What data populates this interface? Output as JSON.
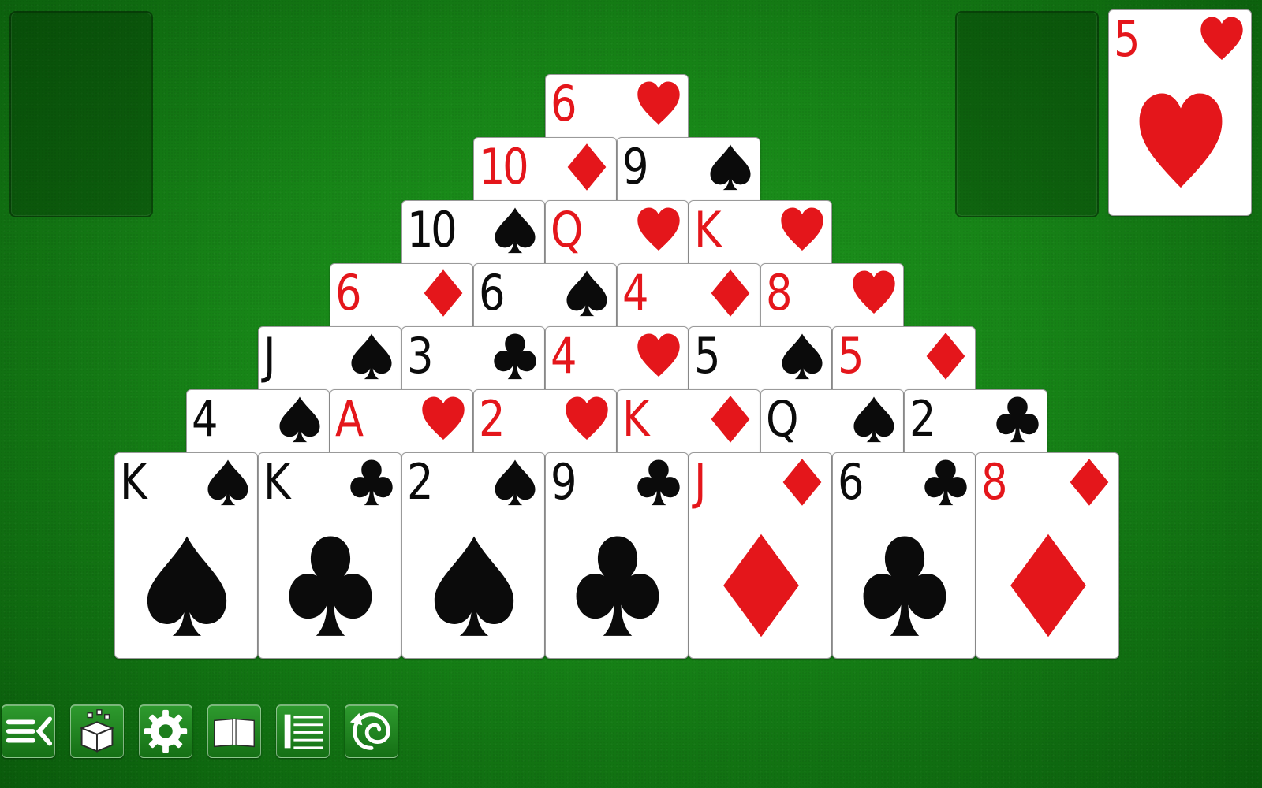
{
  "colors": {
    "felt": "#178417",
    "red_suit": "#e4161b",
    "black_suit": "#0b0b0b",
    "card_face": "#ffffff"
  },
  "waste": {
    "label": ""
  },
  "stock": {
    "label": ""
  },
  "drawn_card": {
    "rank": "5",
    "suit": "hearts"
  },
  "pyramid": [
    [
      {
        "rank": "6",
        "suit": "hearts"
      }
    ],
    [
      {
        "rank": "10",
        "suit": "diamonds"
      },
      {
        "rank": "9",
        "suit": "spades"
      }
    ],
    [
      {
        "rank": "10",
        "suit": "spades"
      },
      {
        "rank": "Q",
        "suit": "hearts"
      },
      {
        "rank": "K",
        "suit": "hearts"
      }
    ],
    [
      {
        "rank": "6",
        "suit": "diamonds"
      },
      {
        "rank": "6",
        "suit": "spades"
      },
      {
        "rank": "4",
        "suit": "diamonds"
      },
      {
        "rank": "8",
        "suit": "hearts"
      }
    ],
    [
      {
        "rank": "J",
        "suit": "spades"
      },
      {
        "rank": "3",
        "suit": "clubs"
      },
      {
        "rank": "4",
        "suit": "hearts"
      },
      {
        "rank": "5",
        "suit": "spades"
      },
      {
        "rank": "5",
        "suit": "diamonds"
      }
    ],
    [
      {
        "rank": "4",
        "suit": "spades"
      },
      {
        "rank": "A",
        "suit": "hearts"
      },
      {
        "rank": "2",
        "suit": "hearts"
      },
      {
        "rank": "K",
        "suit": "diamonds"
      },
      {
        "rank": "Q",
        "suit": "spades"
      },
      {
        "rank": "2",
        "suit": "clubs"
      }
    ],
    [
      {
        "rank": "K",
        "suit": "spades"
      },
      {
        "rank": "K",
        "suit": "clubs"
      },
      {
        "rank": "2",
        "suit": "spades"
      },
      {
        "rank": "9",
        "suit": "clubs"
      },
      {
        "rank": "J",
        "suit": "diamonds"
      },
      {
        "rank": "6",
        "suit": "clubs"
      },
      {
        "rank": "8",
        "suit": "diamonds"
      }
    ]
  ],
  "toolbar": [
    {
      "name": "menu-button",
      "icon": "menu-collapse-icon"
    },
    {
      "name": "new-game-button",
      "icon": "gift-box-icon"
    },
    {
      "name": "settings-button",
      "icon": "gear-icon"
    },
    {
      "name": "rules-button",
      "icon": "book-icon"
    },
    {
      "name": "statistics-button",
      "icon": "list-icon"
    },
    {
      "name": "undo-button",
      "icon": "undo-spiral-icon"
    }
  ]
}
